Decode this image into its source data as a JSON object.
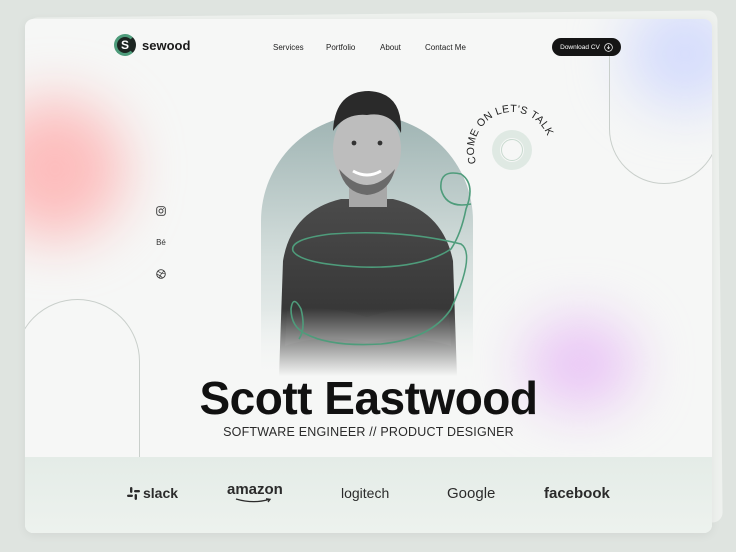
{
  "brand": {
    "name": "sewood",
    "mark": "S",
    "accent": "#4e9c7b"
  },
  "nav": {
    "items": [
      "Services",
      "Portfolio",
      "About",
      "Contact Me"
    ]
  },
  "cta": {
    "download_label": "Download CV"
  },
  "social": {
    "behance_label": "Bé"
  },
  "badge": {
    "text": "COME ON LET'S TALK"
  },
  "hero": {
    "name": "Scott Eastwood",
    "title": "SOFTWARE ENGINEER // PRODUCT DESIGNER"
  },
  "clients": [
    "slack",
    "amazon",
    "logitech",
    "Google",
    "facebook"
  ],
  "icons": [
    "instagram-icon",
    "behance-icon",
    "dribbble-icon",
    "download-icon",
    "slack-logo-icon"
  ]
}
